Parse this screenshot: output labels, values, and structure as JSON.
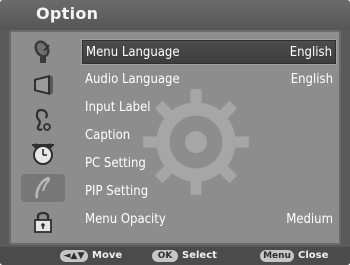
{
  "header": {
    "title": "Option"
  },
  "sidebar": {
    "icons": [
      {
        "name": "satellite-dish-icon"
      },
      {
        "name": "picture-icon"
      },
      {
        "name": "audio-icon"
      },
      {
        "name": "alarm-clock-icon"
      },
      {
        "name": "option-icon",
        "active": true
      },
      {
        "name": "lock-icon"
      }
    ]
  },
  "menu": {
    "items": [
      {
        "label": "Menu Language",
        "value": "English",
        "selected": true
      },
      {
        "label": "Audio Language",
        "value": "English"
      },
      {
        "label": "Input Label",
        "value": ""
      },
      {
        "label": "Caption",
        "value": ""
      },
      {
        "label": "PC Setting",
        "value": ""
      },
      {
        "label": "PIP Setting",
        "value": ""
      },
      {
        "label": "Menu Opacity",
        "value": "Medium"
      }
    ]
  },
  "footer": {
    "move": {
      "key": "◄▲▼",
      "label": "Move"
    },
    "select": {
      "key": "OK",
      "label": "Select"
    },
    "close": {
      "key": "Menu",
      "label": "Close"
    }
  },
  "colors": {
    "background": "#5a5a5a",
    "panel": "#8d8d8d",
    "highlight": "#3f3f3f",
    "text": "#ffffff"
  }
}
